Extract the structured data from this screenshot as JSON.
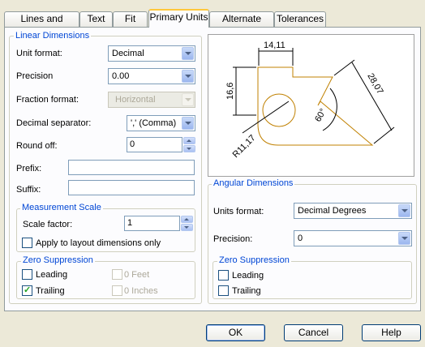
{
  "tabs": [
    {
      "label": "Lines and Arrows",
      "active": false
    },
    {
      "label": "Text",
      "active": false
    },
    {
      "label": "Fit",
      "active": false
    },
    {
      "label": "Primary Units",
      "active": true
    },
    {
      "label": "Alternate Units",
      "active": false
    },
    {
      "label": "Tolerances",
      "active": false
    }
  ],
  "linear": {
    "title": "Linear Dimensions",
    "unit_format_label": "Unit format:",
    "unit_format_value": "Decimal",
    "precision_label": "Precision",
    "precision_value": "0.00",
    "fraction_label": "Fraction format:",
    "fraction_value": "Horizontal",
    "decimal_sep_label": "Decimal separator:",
    "decimal_sep_value": "',' (Comma)",
    "roundoff_label": "Round off:",
    "roundoff_value": "0",
    "prefix_label": "Prefix:",
    "prefix_value": "",
    "suffix_label": "Suffix:",
    "suffix_value": ""
  },
  "measurement": {
    "title": "Measurement Scale",
    "scale_label": "Scale factor:",
    "scale_value": "1",
    "apply_label": "Apply to layout dimensions only",
    "apply_checked": false
  },
  "zero_linear": {
    "title": "Zero Suppression",
    "leading_label": "Leading",
    "leading_checked": false,
    "trailing_label": "Trailing",
    "trailing_checked": true,
    "feet_label": "0 Feet",
    "inches_label": "0 Inches"
  },
  "preview": {
    "dim_top": "14,11",
    "dim_left": "16,6",
    "dim_right": "28,07",
    "dim_angle": "60°",
    "dim_radius": "R11,17"
  },
  "angular": {
    "title": "Angular Dimensions",
    "units_label": "Units format:",
    "units_value": "Decimal Degrees",
    "precision_label": "Precision:",
    "precision_value": "0"
  },
  "zero_angular": {
    "title": "Zero Suppression",
    "leading_label": "Leading",
    "leading_checked": false,
    "trailing_label": "Trailing",
    "trailing_checked": false
  },
  "buttons": {
    "ok": "OK",
    "cancel": "Cancel",
    "help": "Help"
  },
  "colors": {
    "accent": "#0046d5",
    "tab_highlight": "#ffc83c",
    "preview_shape": "#c08000",
    "check": "#21a121"
  }
}
